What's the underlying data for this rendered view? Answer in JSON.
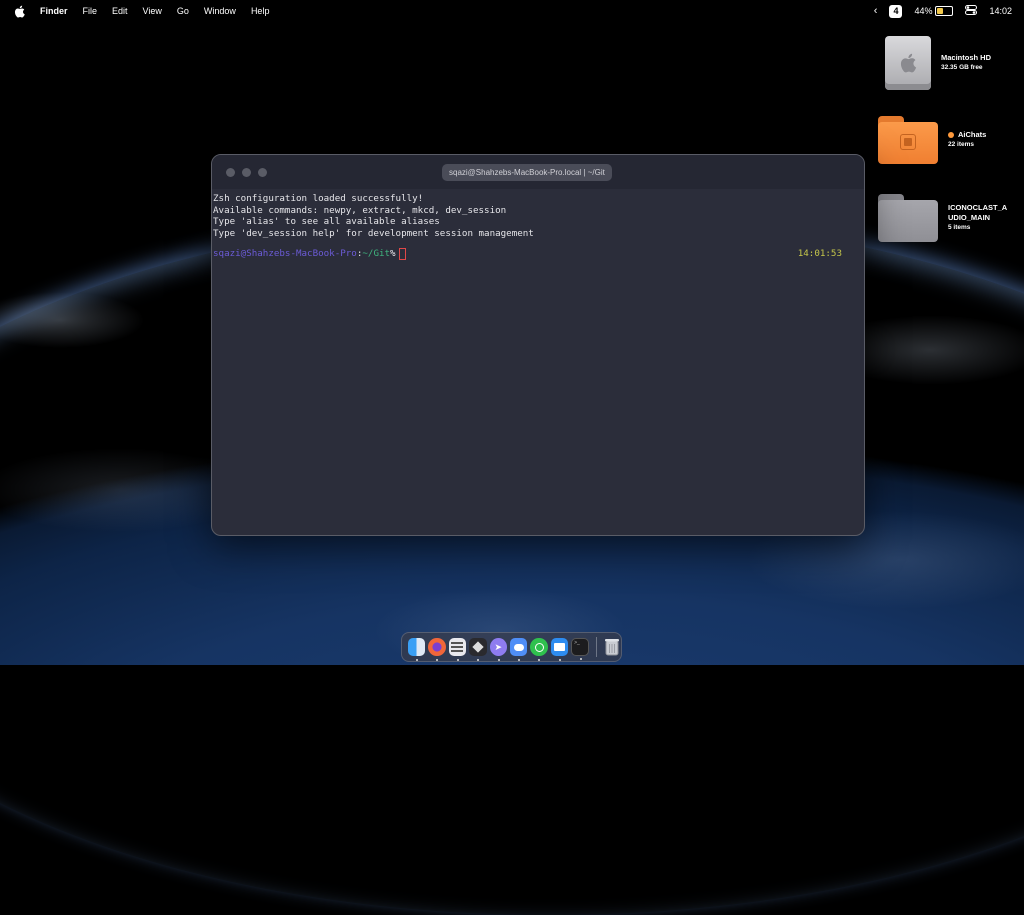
{
  "menubar": {
    "app_name": "Finder",
    "items": [
      "File",
      "Edit",
      "View",
      "Go",
      "Window",
      "Help"
    ],
    "desktop_number": "4",
    "battery_percent": "44%",
    "battery_level": 0.44,
    "time": "14:02"
  },
  "desktop_icons": [
    {
      "name": "Macintosh HD",
      "sub": "32.35 GB free",
      "icon": "hard-drive-icon"
    },
    {
      "name": "AiChats",
      "sub": "22 items",
      "icon": "folder-icon",
      "tag_color": "#ff9a3c"
    },
    {
      "name": "ICONOCLAST_A",
      "name2": "UDIO_MAIN",
      "sub": "5 items",
      "icon": "folder-icon"
    }
  ],
  "terminal": {
    "title": "sqazi@Shahzebs-MacBook-Pro.local | ~/Git",
    "output": [
      "Zsh configuration loaded successfully!",
      "Available commands: newpy, extract, mkcd, dev_session",
      "Type 'alias' to see all available aliases",
      "Type 'dev_session help' for development session management"
    ],
    "prompt_user": "sqazi@Shahzebs-MacBook-Pro",
    "prompt_sep": ":",
    "prompt_path": "~/Git",
    "prompt_symbol": "%",
    "prompt_time": "14:01:53"
  },
  "dock": {
    "apps": [
      "Finder",
      "Firefox",
      "Notes",
      "Sandbox",
      "Telegram",
      "Messages",
      "WhatsApp",
      "Mail",
      "Terminal"
    ],
    "trash": "Trash"
  },
  "colors": {
    "terminal_bg": "#2b2d3a",
    "prompt_user": "#6b5bd6",
    "prompt_path": "#3fb47e",
    "prompt_time": "#c5c64a",
    "folder_orange": "#f7893a",
    "folder_gray": "#9a9aa0"
  }
}
